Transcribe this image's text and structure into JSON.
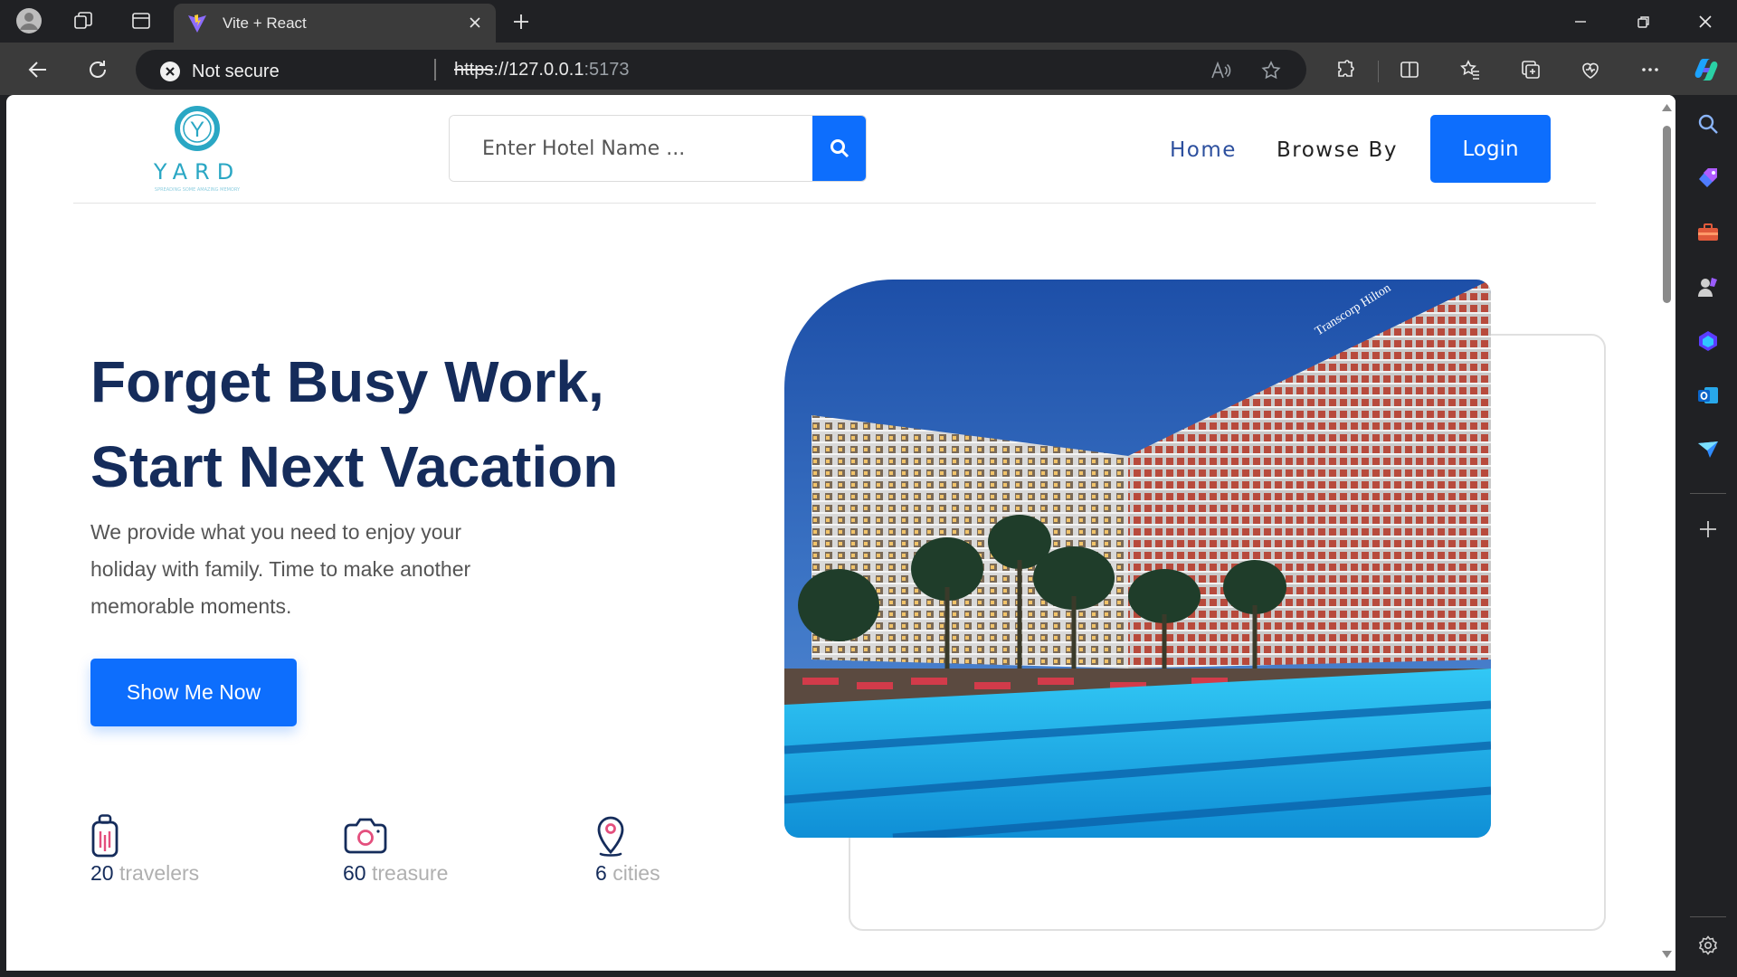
{
  "browser": {
    "tab_title": "Vite + React",
    "security_label": "Not secure",
    "url_scheme": "https",
    "url_host": "://127.0.0.1",
    "url_port": ":5173"
  },
  "logo": {
    "text": "YARD",
    "letter": "Y",
    "tagline": "SPREADING SOME AMAZING MEMORY"
  },
  "search": {
    "placeholder": "Enter Hotel Name ..."
  },
  "nav": {
    "home": "Home",
    "browse": "Browse By",
    "login": "Login"
  },
  "hero": {
    "title_line1": "Forget Busy Work,",
    "title_line2": "Start Next Vacation",
    "description": "We provide what you need to enjoy your holiday with family. Time to make another memorable moments.",
    "cta": "Show Me Now",
    "image_sign": "Transcorp Hilton"
  },
  "stats": [
    {
      "value": "20",
      "label": "travelers",
      "icon": "luggage-icon"
    },
    {
      "value": "60",
      "label": "treasure",
      "icon": "camera-icon"
    },
    {
      "value": "6",
      "label": "cities",
      "icon": "location-pin-icon"
    }
  ],
  "colors": {
    "primary": "#0d6efd",
    "heading": "#152c5b",
    "accent_icon": "#e44f7d"
  }
}
